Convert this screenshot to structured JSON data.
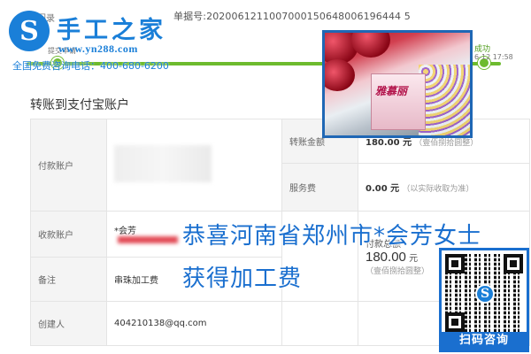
{
  "header": {
    "back_link": "退回录",
    "receipt_number": "单据号:2020061211007000150648006196444 5"
  },
  "progress": {
    "step1_label": "提交申请",
    "step_success_label": "成功",
    "step_success_time": "6-12 17:58",
    "accent_color": "#6dbb2e"
  },
  "brand": {
    "mark": "S",
    "name": "手工之家",
    "url": "www.yn288.com",
    "hotline": "全国免费咨询电话：400-680-6200",
    "color": "#1a7fd8"
  },
  "photo": {
    "product_logo": "雅慕丽"
  },
  "page": {
    "title": "转账到支付宝账户"
  },
  "table": {
    "payer_label": "付款账户",
    "transfer_amount_label": "转账金额",
    "transfer_amount_value": "180.00 元",
    "transfer_amount_note": "（壹佰捌拾圆整）",
    "service_fee_label": "服务费",
    "service_fee_value": "0.00 元",
    "service_fee_note": "（以实际收取为准）",
    "payee_label": "收款账户",
    "payee_name": "*会芳",
    "total_label": "付款总额",
    "total_value": "180.00",
    "total_unit": "元",
    "total_note": "（壹佰捌拾圆整）",
    "remark_label": "备注",
    "remark_value": "串珠加工费",
    "creator_label": "创建人",
    "creator_value": "404210138@qq.com"
  },
  "announcement": {
    "line1": "恭喜河南省郑州市*会芳女士",
    "line2": "获得加工费",
    "color": "#1a6fcf"
  },
  "qr": {
    "center_mark": "S",
    "label": "扫码咨询"
  }
}
